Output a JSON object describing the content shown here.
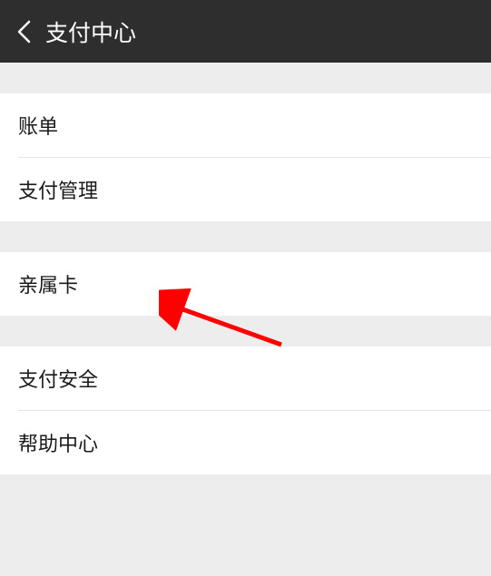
{
  "header": {
    "title": "支付中心"
  },
  "section1": {
    "items": [
      {
        "label": "账单"
      },
      {
        "label": "支付管理"
      }
    ]
  },
  "section2": {
    "items": [
      {
        "label": "亲属卡"
      }
    ]
  },
  "section3": {
    "items": [
      {
        "label": "支付安全"
      },
      {
        "label": "帮助中心"
      }
    ]
  }
}
